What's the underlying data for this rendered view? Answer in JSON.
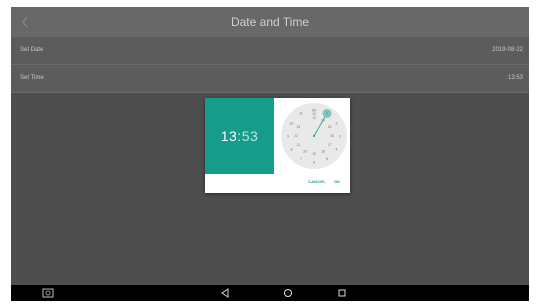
{
  "header": {
    "title": "Date and Time",
    "back_icon": "chevron-left-icon"
  },
  "settings": [
    {
      "label": "Set Date",
      "value": "2019-08-22"
    },
    {
      "label": "Set Time",
      "value": "13:53"
    }
  ],
  "dialog": {
    "hour": "13",
    "separator": ":",
    "minute": "53",
    "clock_outer_numbers": [
      "00",
      "1",
      "2",
      "3",
      "4",
      "5",
      "6",
      "7",
      "8",
      "9",
      "10",
      "11",
      "12"
    ],
    "clock_inner_numbers": [
      "13",
      "14",
      "15",
      "16",
      "17",
      "18",
      "19",
      "20",
      "21",
      "22",
      "23"
    ],
    "selected_hour": "13",
    "cancel_label": "CANCEL",
    "ok_label": "OK",
    "accent_color": "#159c8a"
  },
  "navbar": {
    "icons": [
      "screenshot-icon",
      "back-triangle-icon",
      "home-circle-icon",
      "recents-square-icon"
    ]
  }
}
